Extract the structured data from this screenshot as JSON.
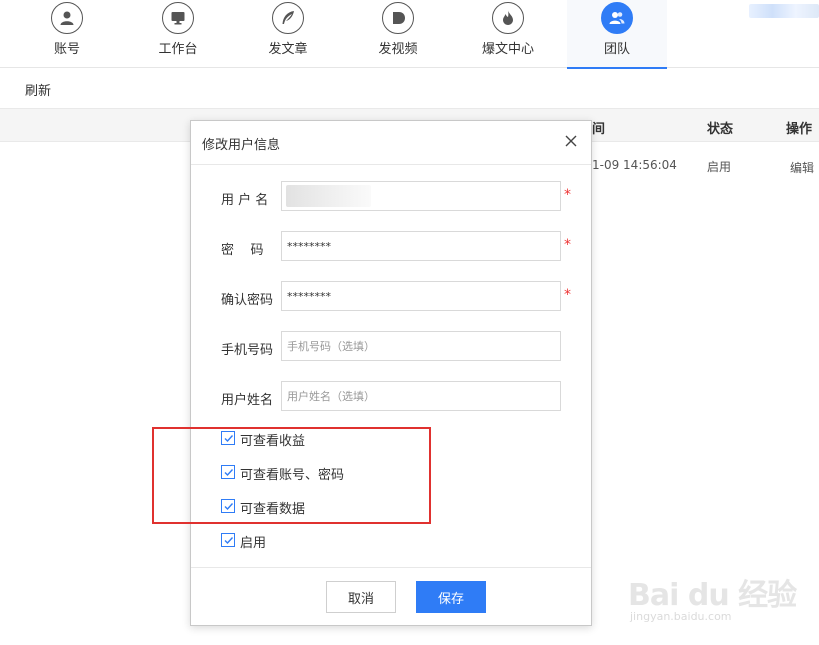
{
  "nav": {
    "items": [
      {
        "label": "账号",
        "icon": "user-icon"
      },
      {
        "label": "工作台",
        "icon": "monitor-icon"
      },
      {
        "label": "发文章",
        "icon": "feather-icon"
      },
      {
        "label": "发视频",
        "icon": "play-icon"
      },
      {
        "label": "爆文中心",
        "icon": "flame-icon"
      },
      {
        "label": "团队",
        "icon": "team-icon",
        "active": true
      }
    ],
    "accent": "#2f7cf6"
  },
  "toolbar": {
    "refresh_label": "刷新"
  },
  "table": {
    "headers": {
      "status": "状态",
      "action": "操作"
    },
    "partial_time_header": "间",
    "row": {
      "time": "1-09 14:56:04",
      "status": "启用",
      "action": "编辑"
    }
  },
  "modal": {
    "title": "修改用户信息",
    "fields": {
      "username": {
        "label": "用 户 名"
      },
      "password": {
        "label": "密    码",
        "value": "********"
      },
      "confirm": {
        "label": "确认密码",
        "value": "********"
      },
      "phone": {
        "label": "手机号码",
        "placeholder": "手机号码（选填）"
      },
      "realname": {
        "label": "用户姓名",
        "placeholder": "用户姓名（选填）"
      }
    },
    "required_mark": "*",
    "checkboxes": [
      {
        "label": "可查看收益",
        "checked": true
      },
      {
        "label": "可查看账号、密码",
        "checked": true
      },
      {
        "label": "可查看数据",
        "checked": true
      },
      {
        "label": "启用",
        "checked": true
      }
    ],
    "cancel_label": "取消",
    "save_label": "保存"
  },
  "watermark": {
    "main": "Bai du 经验",
    "sub": "jingyan.baidu.com"
  },
  "colors": {
    "highlight": "#e0312f",
    "required": "#e33333"
  }
}
